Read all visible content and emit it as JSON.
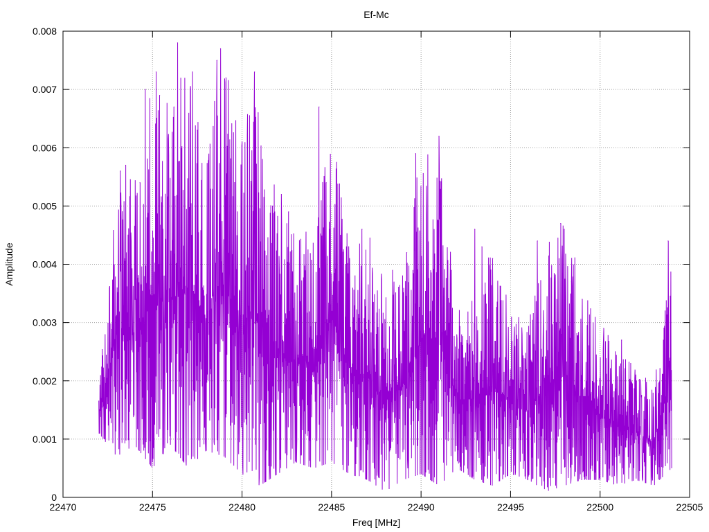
{
  "chart_data": {
    "type": "line",
    "title": "Ef-Mc",
    "xlabel": "Freq [MHz]",
    "ylabel": "Amplitude",
    "xlim": [
      22470,
      22505
    ],
    "ylim": [
      0,
      0.008
    ],
    "xticks": [
      22470,
      22475,
      22480,
      22485,
      22490,
      22495,
      22500,
      22505
    ],
    "yticks": [
      0,
      0.001,
      0.002,
      0.003,
      0.004,
      0.005,
      0.006,
      0.007,
      0.008
    ],
    "ytick_labels": [
      "0",
      "0.001",
      "0.002",
      "0.003",
      "0.004",
      "0.005",
      "0.006",
      "0.007",
      "0.008"
    ],
    "grid": true,
    "series": [
      {
        "color": "#9400d3",
        "x_start": 22472.0,
        "x_end": 22504.0,
        "envelope_x": [
          22472.0,
          22473.0,
          22474.0,
          22475.0,
          22476.0,
          22477.0,
          22478.0,
          22479.0,
          22480.0,
          22481.0,
          22482.0,
          22483.0,
          22484.0,
          22485.0,
          22486.0,
          22487.0,
          22488.0,
          22489.0,
          22490.0,
          22491.0,
          22492.0,
          22493.0,
          22494.0,
          22495.0,
          22496.0,
          22497.0,
          22498.0,
          22499.0,
          22500.0,
          22501.0,
          22502.0,
          22503.0,
          22504.0
        ],
        "envelope_max": [
          0.0019,
          0.0057,
          0.0055,
          0.0073,
          0.0068,
          0.0078,
          0.0062,
          0.0077,
          0.0064,
          0.0073,
          0.0052,
          0.0048,
          0.0044,
          0.0067,
          0.0045,
          0.0046,
          0.0038,
          0.0042,
          0.0059,
          0.0062,
          0.0033,
          0.0036,
          0.0043,
          0.0033,
          0.0031,
          0.0044,
          0.0047,
          0.0038,
          0.0029,
          0.0027,
          0.0023,
          0.0019,
          0.0044
        ],
        "envelope_min": [
          0.0011,
          0.0007,
          0.0009,
          0.0005,
          0.0009,
          0.0005,
          0.0008,
          0.0007,
          0.0004,
          0.0002,
          0.0004,
          0.0006,
          0.0005,
          0.0006,
          0.0004,
          0.0003,
          0.0001,
          0.0003,
          0.0004,
          0.0002,
          0.0005,
          0.0003,
          0.0002,
          0.0004,
          0.0003,
          0.0001,
          0.0002,
          0.0003,
          0.0003,
          0.0002,
          0.0003,
          0.0002,
          0.0005
        ],
        "peaks": [
          {
            "x": 22473.2,
            "y": 0.0056
          },
          {
            "x": 22473.5,
            "y": 0.0057
          },
          {
            "x": 22474.3,
            "y": 0.0054
          },
          {
            "x": 22474.6,
            "y": 0.007
          },
          {
            "x": 22475.2,
            "y": 0.0073
          },
          {
            "x": 22475.4,
            "y": 0.0069
          },
          {
            "x": 22476.2,
            "y": 0.0067
          },
          {
            "x": 22476.4,
            "y": 0.0078
          },
          {
            "x": 22477.1,
            "y": 0.007
          },
          {
            "x": 22477.5,
            "y": 0.0063
          },
          {
            "x": 22478.6,
            "y": 0.0075
          },
          {
            "x": 22478.8,
            "y": 0.0077
          },
          {
            "x": 22479.1,
            "y": 0.0072
          },
          {
            "x": 22480.0,
            "y": 0.0061
          },
          {
            "x": 22480.7,
            "y": 0.0073
          },
          {
            "x": 22480.9,
            "y": 0.0066
          },
          {
            "x": 22481.7,
            "y": 0.005
          },
          {
            "x": 22482.2,
            "y": 0.0052
          },
          {
            "x": 22482.6,
            "y": 0.0049
          },
          {
            "x": 22484.3,
            "y": 0.0067
          },
          {
            "x": 22484.7,
            "y": 0.0054
          },
          {
            "x": 22485.5,
            "y": 0.0045
          },
          {
            "x": 22486.0,
            "y": 0.0041
          },
          {
            "x": 22486.7,
            "y": 0.0046
          },
          {
            "x": 22489.2,
            "y": 0.0042
          },
          {
            "x": 22489.7,
            "y": 0.0059
          },
          {
            "x": 22491.0,
            "y": 0.0062
          },
          {
            "x": 22493.0,
            "y": 0.0046
          },
          {
            "x": 22493.4,
            "y": 0.0043
          },
          {
            "x": 22494.0,
            "y": 0.0041
          },
          {
            "x": 22496.5,
            "y": 0.0044
          },
          {
            "x": 22497.8,
            "y": 0.0047
          },
          {
            "x": 22498.0,
            "y": 0.0046
          },
          {
            "x": 22498.4,
            "y": 0.0037
          },
          {
            "x": 22499.0,
            "y": 0.0034
          },
          {
            "x": 22500.2,
            "y": 0.0029
          },
          {
            "x": 22501.2,
            "y": 0.0027
          },
          {
            "x": 22503.8,
            "y": 0.0044
          }
        ],
        "points": 2000
      }
    ]
  }
}
